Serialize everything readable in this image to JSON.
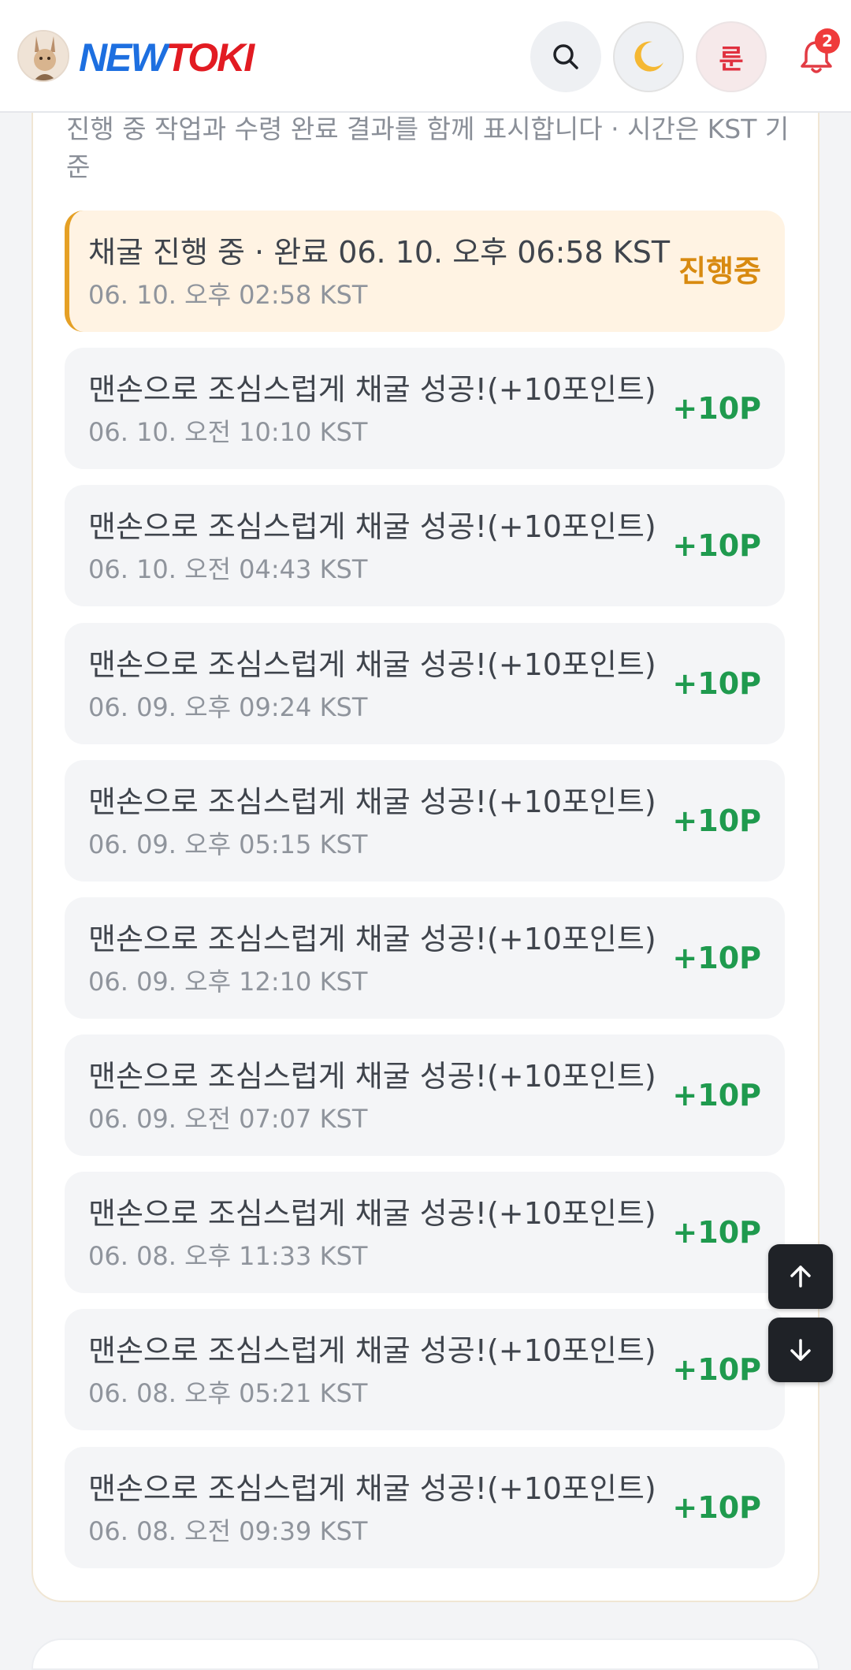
{
  "header": {
    "logo_new": "NEW",
    "logo_toki": "TOKI",
    "rune_label": "룬",
    "notification_count": "2"
  },
  "panel": {
    "subtitle": "진행 중 작업과 수령 완료 결과를 함께 표시합니다 · 시간은 KST 기준",
    "rows": [
      {
        "title": "채굴 진행 중 · 완료 06. 10. 오후 06:58 KST",
        "time": "06. 10. 오후 02:58 KST",
        "value": "진행중"
      },
      {
        "title": "맨손으로 조심스럽게 채굴 성공!(+10포인트)",
        "time": "06. 10. 오전 10:10 KST",
        "value": "+10P"
      },
      {
        "title": "맨손으로 조심스럽게 채굴 성공!(+10포인트)",
        "time": "06. 10. 오전 04:43 KST",
        "value": "+10P"
      },
      {
        "title": "맨손으로 조심스럽게 채굴 성공!(+10포인트)",
        "time": "06. 09. 오후 09:24 KST",
        "value": "+10P"
      },
      {
        "title": "맨손으로 조심스럽게 채굴 성공!(+10포인트)",
        "time": "06. 09. 오후 05:15 KST",
        "value": "+10P"
      },
      {
        "title": "맨손으로 조심스럽게 채굴 성공!(+10포인트)",
        "time": "06. 09. 오후 12:10 KST",
        "value": "+10P"
      },
      {
        "title": "맨손으로 조심스럽게 채굴 성공!(+10포인트)",
        "time": "06. 09. 오전 07:07 KST",
        "value": "+10P"
      },
      {
        "title": "맨손으로 조심스럽게 채굴 성공!(+10포인트)",
        "time": "06. 08. 오후 11:33 KST",
        "value": "+10P"
      },
      {
        "title": "맨손으로 조심스럽게 채굴 성공!(+10포인트)",
        "time": "06. 08. 오후 05:21 KST",
        "value": "+10P"
      },
      {
        "title": "맨손으로 조심스럽게 채굴 성공!(+10포인트)",
        "time": "06. 08. 오전 09:39 KST",
        "value": "+10P"
      }
    ]
  },
  "icons": {
    "search": "search-icon",
    "theme": "moon-icon",
    "bell": "bell-icon",
    "scroll_up": "arrow-up-icon",
    "scroll_down": "arrow-down-icon"
  },
  "colors": {
    "accent_in_progress": "#e5a025",
    "in_progress_text": "#d88a10",
    "reward_text": "#1f9a4e",
    "logo_blue": "#1d6fe0",
    "logo_red": "#e21b22",
    "badge_red": "#ef3b3b"
  }
}
